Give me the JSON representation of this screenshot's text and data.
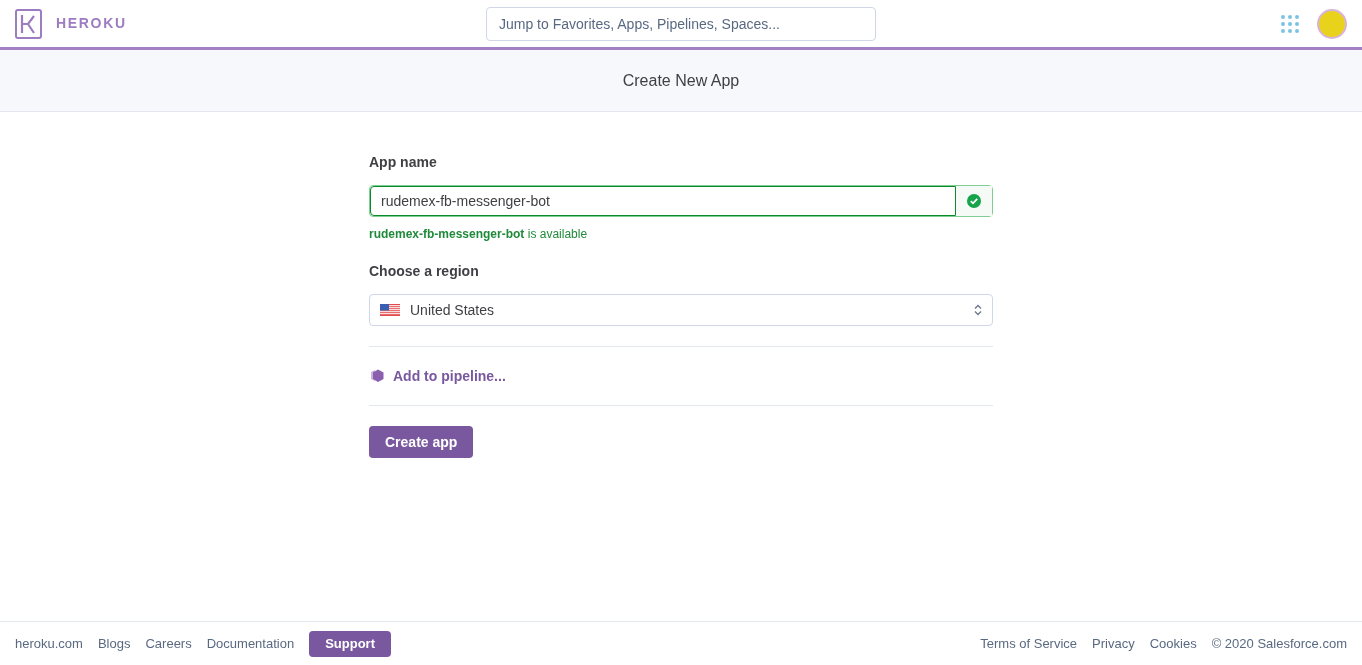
{
  "header": {
    "logo_text": "HEROKU",
    "search": {
      "placeholder": "Jump to Favorites, Apps, Pipelines, Spaces..."
    }
  },
  "page_title": "Create New App",
  "form": {
    "app_name": {
      "label": "App name",
      "value": "rudemex-fb-messenger-bot",
      "valid": true,
      "message": "**rudemex-fb-messenger-bot** is available"
    },
    "region": {
      "label": "Choose a region",
      "value": "United States"
    },
    "pipeline_link": "Add to pipeline...",
    "submit": "Create app"
  },
  "footer": {
    "left_links": [
      "heroku.com",
      "Blogs",
      "Careers",
      "Documentation"
    ],
    "support": "Support",
    "right_links": [
      "Terms of Service",
      "Privacy",
      "Cookies"
    ],
    "copyright": "© 2020 Salesforce.com"
  }
}
